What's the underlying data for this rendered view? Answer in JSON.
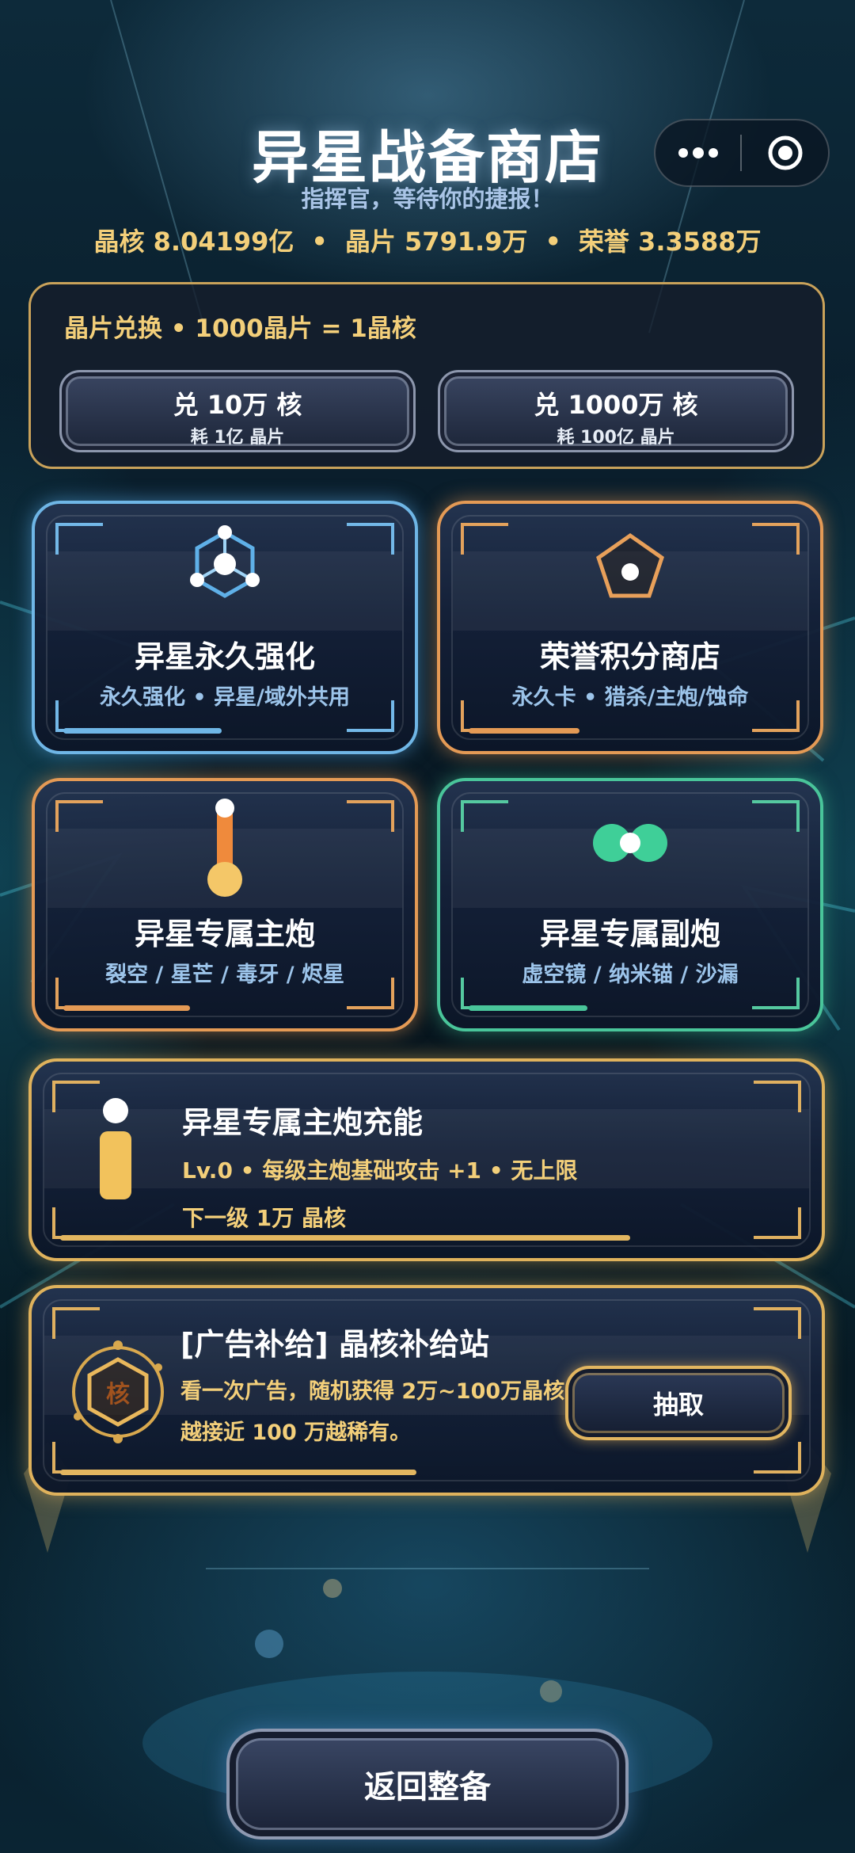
{
  "header": {
    "title": "异星战备商店",
    "subtitle": "指挥官，等待你的捷报！",
    "stats": {
      "core": "晶核 8.04199亿",
      "chip": "晶片 5791.9万",
      "honor": "荣誉 3.3588万",
      "separator": "•"
    },
    "capsule": {
      "more_icon": "more-dots-icon",
      "close_icon": "target-close-icon"
    }
  },
  "exchange": {
    "title": "晶片兑换 • 1000晶片 = 1晶核",
    "buttons": [
      {
        "label": "兑 10万 核",
        "cost": "耗 1亿 晶片"
      },
      {
        "label": "兑 1000万 核",
        "cost": "耗 100亿 晶片"
      }
    ]
  },
  "cards": [
    {
      "title": "异星永久强化",
      "subtitle": "永久强化 • 异星/域外共用",
      "icon": "molecule-hex-icon",
      "accent": "#6fb6e6"
    },
    {
      "title": "荣誉积分商店",
      "subtitle": "永久卡 • 猎杀/主炮/蚀命",
      "icon": "pentagon-icon",
      "accent": "#e49a55"
    },
    {
      "title": "异星专属主炮",
      "subtitle": "裂空 / 星芒 / 毒牙 / 烬星",
      "icon": "cannon-icon",
      "accent": "#e49a55"
    },
    {
      "title": "异星专属副炮",
      "subtitle": "虚空镜 / 纳米锚 / 沙漏",
      "icon": "twin-orb-icon",
      "accent": "#49c59a"
    }
  ],
  "charge": {
    "title": "异星专属主炮充能",
    "detail": "Lv.0 • 每级主炮基础攻击 +1 • 无上限",
    "next": "下一级 1万 晶核",
    "icon": "charge-capsule-icon"
  },
  "supply": {
    "title": "[广告补给] 晶核补给站",
    "line1": "看一次广告，随机获得 2万~100万晶核",
    "line2": "越接近 100 万越稀有。",
    "badge_text": "核",
    "button": "抽取"
  },
  "footer": {
    "back_button": "返回整备"
  },
  "colors": {
    "gold_text": "#f3cf7a",
    "blue_sub": "#9cc4ea",
    "orange_sub": "#f2b27a",
    "green_sub": "#86d9bf"
  }
}
